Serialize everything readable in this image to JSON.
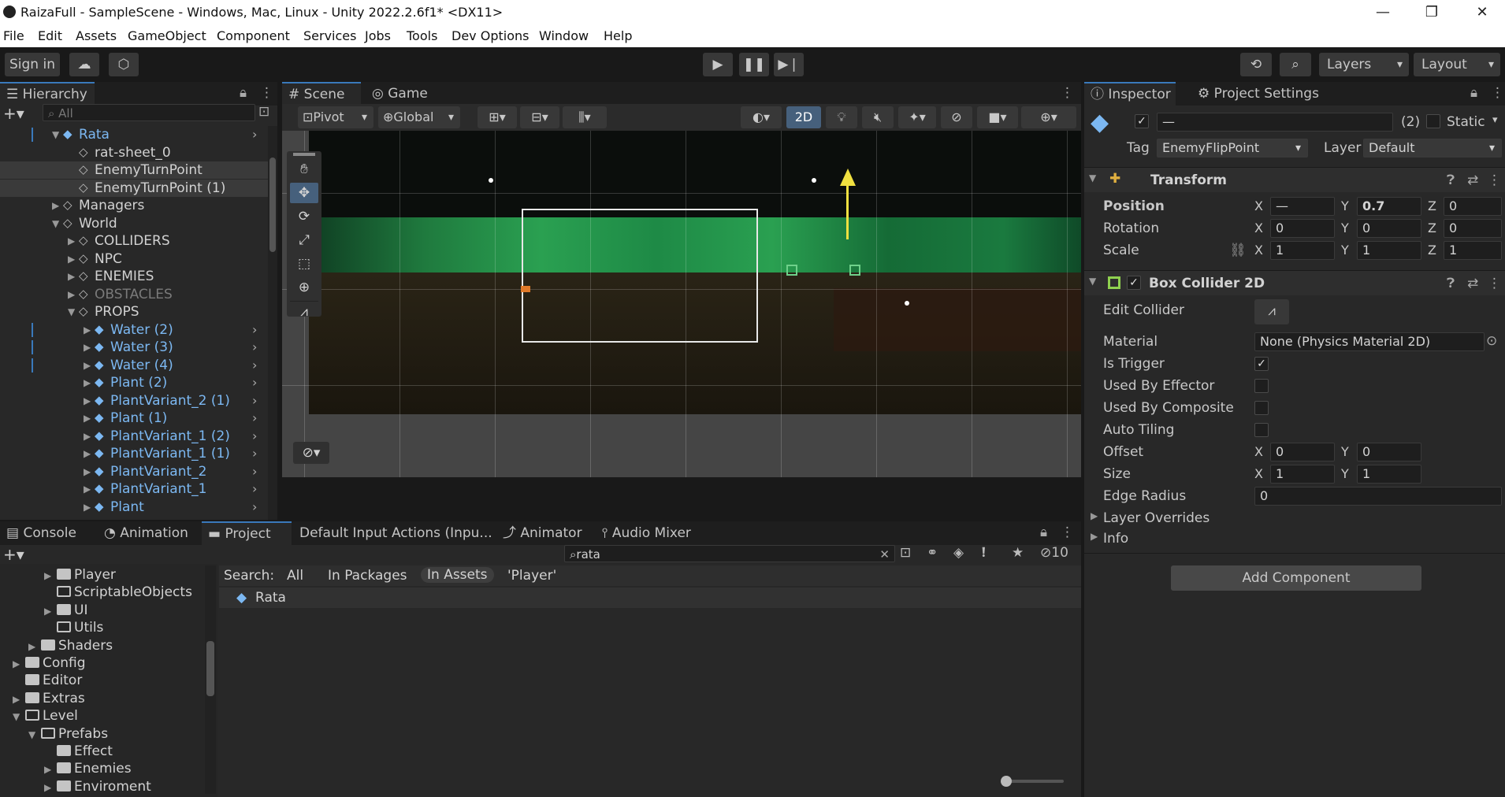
{
  "window": {
    "title": "RaizaFull - SampleScene - Windows, Mac, Linux - Unity 2022.2.6f1* <DX11>",
    "minimize": "—",
    "maximize": "❐",
    "close": "✕"
  },
  "menu": [
    "File",
    "Edit",
    "Assets",
    "GameObject",
    "Component",
    "Services",
    "Jobs",
    "Tools",
    "Dev Options",
    "Window",
    "Help"
  ],
  "toolbar": {
    "sign_in": "Sign in",
    "layers": "Layers",
    "layout": "Layout"
  },
  "hierarchy": {
    "tab": "Hierarchy",
    "search_placeholder": "All",
    "rows": [
      {
        "label": "Rata",
        "indent": 1,
        "expanded": true,
        "prefab": true
      },
      {
        "label": "rat-sheet_0",
        "indent": 2
      },
      {
        "label": "EnemyTurnPoint",
        "indent": 2,
        "selected": true
      },
      {
        "label": "EnemyTurnPoint (1)",
        "indent": 2,
        "selected": true
      },
      {
        "label": "Managers",
        "indent": 1,
        "collapsed": true
      },
      {
        "label": "World",
        "indent": 1,
        "expanded": true
      },
      {
        "label": "COLLIDERS",
        "indent": 2,
        "collapsed": true
      },
      {
        "label": "NPC",
        "indent": 2,
        "collapsed": true
      },
      {
        "label": "ENEMIES",
        "indent": 2,
        "collapsed": true
      },
      {
        "label": "OBSTACLES",
        "indent": 2,
        "collapsed": true,
        "disabled": true
      },
      {
        "label": "PROPS",
        "indent": 2,
        "expanded": true
      },
      {
        "label": "Water (2)",
        "indent": 3,
        "collapsed": true,
        "prefab": true
      },
      {
        "label": "Water (3)",
        "indent": 3,
        "collapsed": true,
        "prefab": true
      },
      {
        "label": "Water (4)",
        "indent": 3,
        "collapsed": true,
        "prefab": true
      },
      {
        "label": "Plant (2)",
        "indent": 3,
        "collapsed": true,
        "prefab": true
      },
      {
        "label": "PlantVariant_2 (1)",
        "indent": 3,
        "collapsed": true,
        "prefab": true
      },
      {
        "label": "Plant (1)",
        "indent": 3,
        "collapsed": true,
        "prefab": true
      },
      {
        "label": "PlantVariant_1 (2)",
        "indent": 3,
        "collapsed": true,
        "prefab": true
      },
      {
        "label": "PlantVariant_1 (1)",
        "indent": 3,
        "collapsed": true,
        "prefab": true
      },
      {
        "label": "PlantVariant_2",
        "indent": 3,
        "collapsed": true,
        "prefab": true
      },
      {
        "label": "PlantVariant_1",
        "indent": 3,
        "collapsed": true,
        "prefab": true
      },
      {
        "label": "Plant",
        "indent": 3,
        "collapsed": true,
        "prefab": true
      }
    ]
  },
  "scene": {
    "tab_scene": "Scene",
    "tab_game": "Game",
    "pivot": "Pivot",
    "global": "Global",
    "mode_2d": "2D"
  },
  "inspector": {
    "tab_inspector": "Inspector",
    "tab_project_settings": "Project Settings",
    "name_value": "—",
    "count": "(2)",
    "static": "Static",
    "tag_label": "Tag",
    "tag_value": "EnemyFlipPoint",
    "layer_label": "Layer",
    "layer_value": "Default",
    "transform": {
      "title": "Transform",
      "position_label": "Position",
      "rotation_label": "Rotation",
      "scale_label": "Scale",
      "position": {
        "x": "—",
        "y": "0.7",
        "z": "0"
      },
      "rotation": {
        "x": "0",
        "y": "0",
        "z": "0"
      },
      "scale": {
        "x": "1",
        "y": "1",
        "z": "1"
      }
    },
    "box_collider": {
      "title": "Box Collider 2D",
      "edit_collider": "Edit Collider",
      "material_label": "Material",
      "material_value": "None (Physics Material 2D)",
      "is_trigger": "Is Trigger",
      "used_by_effector": "Used By Effector",
      "used_by_composite": "Used By Composite",
      "auto_tiling": "Auto Tiling",
      "offset_label": "Offset",
      "offset": {
        "x": "0",
        "y": "0"
      },
      "size_label": "Size",
      "size": {
        "x": "1",
        "y": "1"
      },
      "edge_radius_label": "Edge Radius",
      "edge_radius": "0",
      "layer_overrides": "Layer Overrides",
      "info": "Info"
    },
    "add_component": "Add Component",
    "axis_x": "X",
    "axis_y": "Y",
    "axis_z": "Z"
  },
  "bottom": {
    "tabs": [
      "Console",
      "Animation",
      "Project",
      "Default Input Actions (Inpu...",
      "Animator",
      "Audio Mixer"
    ],
    "search_value": "rata",
    "hidden_count": "10",
    "search_label": "Search:",
    "filters": [
      "All",
      "In Packages",
      "In Assets",
      "'Player'"
    ],
    "result": "Rata",
    "folders": [
      {
        "label": "Player",
        "indent": 3,
        "arrow": true
      },
      {
        "label": "ScriptableObjects",
        "indent": 3,
        "arrow": false,
        "open": true
      },
      {
        "label": "UI",
        "indent": 3,
        "arrow": true
      },
      {
        "label": "Utils",
        "indent": 3,
        "arrow": false,
        "open": true
      },
      {
        "label": "Shaders",
        "indent": 2,
        "arrow": true
      },
      {
        "label": "Config",
        "indent": 1,
        "arrow": true
      },
      {
        "label": "Editor",
        "indent": 1,
        "arrow": false
      },
      {
        "label": "Extras",
        "indent": 1,
        "arrow": true
      },
      {
        "label": "Level",
        "indent": 1,
        "arrow": true,
        "expanded": true,
        "open": true
      },
      {
        "label": "Prefabs",
        "indent": 2,
        "arrow": true,
        "expanded": true,
        "open": true
      },
      {
        "label": "Effect",
        "indent": 3,
        "arrow": false
      },
      {
        "label": "Enemies",
        "indent": 3,
        "arrow": true
      },
      {
        "label": "Enviroment",
        "indent": 3,
        "arrow": true
      }
    ]
  },
  "colors": {
    "accent": "#3a79bb",
    "prefab_blue": "#7cb8f2",
    "panel": "#282828",
    "gizmo_yellow": "#f0e040"
  }
}
